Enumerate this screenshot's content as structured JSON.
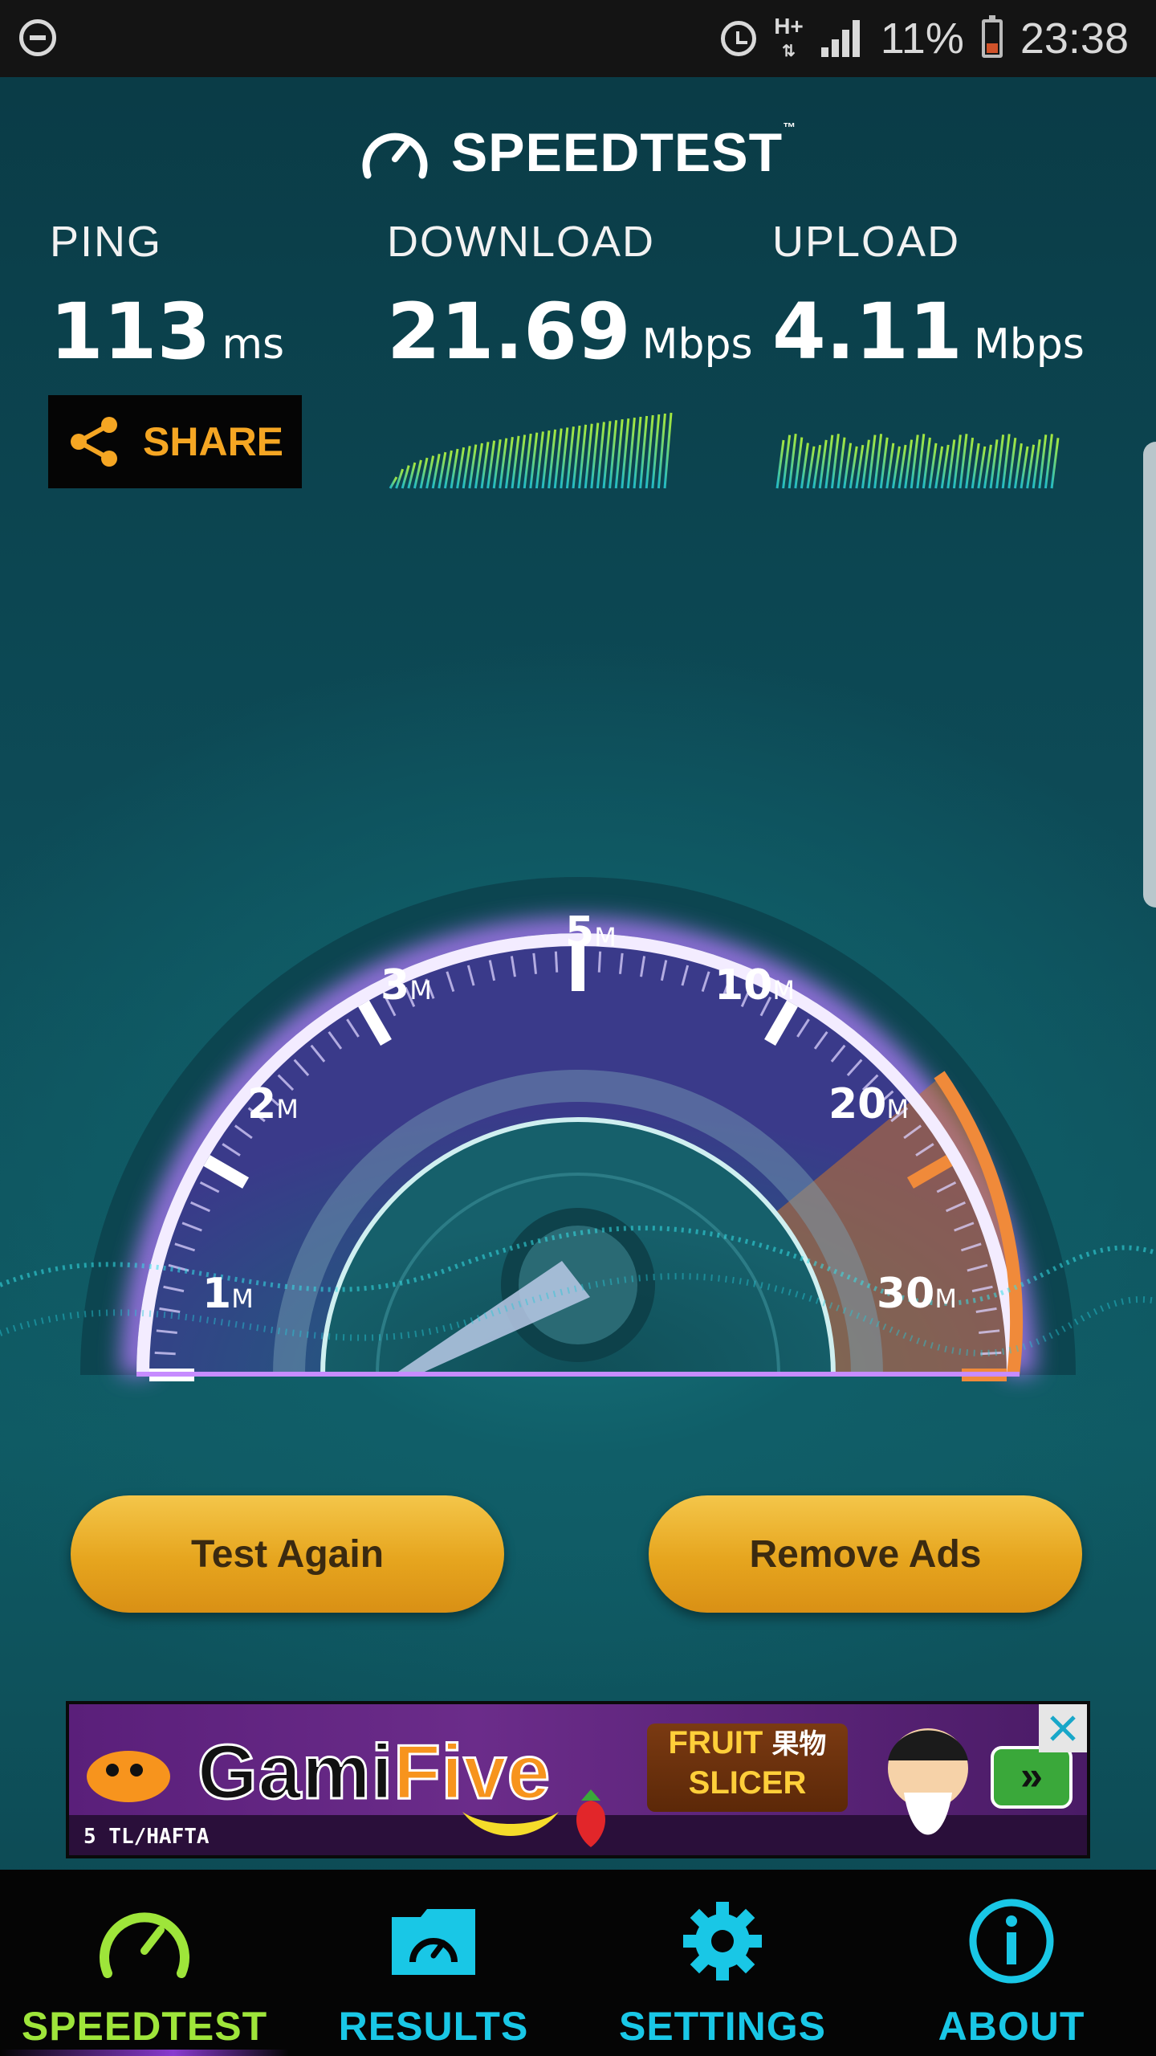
{
  "status_bar": {
    "network": "H+",
    "battery": "11%",
    "time": "23:38"
  },
  "brand": {
    "title": "SPEEDTEST",
    "trademark": "™"
  },
  "metrics": {
    "ping": {
      "label": "PING",
      "value": "113",
      "unit": "ms"
    },
    "download": {
      "label": "DOWNLOAD",
      "value": "21.69",
      "unit": "Mbps"
    },
    "upload": {
      "label": "UPLOAD",
      "value": "4.11",
      "unit": "Mbps"
    }
  },
  "share": {
    "label": "SHARE"
  },
  "gauge": {
    "ticks": [
      {
        "num": "1",
        "unit": "M"
      },
      {
        "num": "2",
        "unit": "M"
      },
      {
        "num": "3",
        "unit": "M"
      },
      {
        "num": "5",
        "unit": "M"
      },
      {
        "num": "10",
        "unit": "M"
      },
      {
        "num": "20",
        "unit": "M"
      },
      {
        "num": "30",
        "unit": "M"
      }
    ]
  },
  "actions": {
    "test_again": "Test Again",
    "remove_ads": "Remove Ads"
  },
  "ad": {
    "brand_part1": "Gami",
    "brand_part2": "Five",
    "price": "5 TL/HAFTA",
    "game_line1": "FRUIT",
    "game_jp": "果物",
    "game_line2": "SLICER",
    "arrow": "»"
  },
  "nav": {
    "items": [
      {
        "label": "SPEEDTEST"
      },
      {
        "label": "RESULTS"
      },
      {
        "label": "SETTINGS"
      },
      {
        "label": "ABOUT"
      }
    ]
  },
  "colors": {
    "accent_green": "#9ee53a",
    "accent_cyan": "#19c7e6",
    "share_orange": "#f5a623",
    "button_gold": "#e6a51e"
  }
}
